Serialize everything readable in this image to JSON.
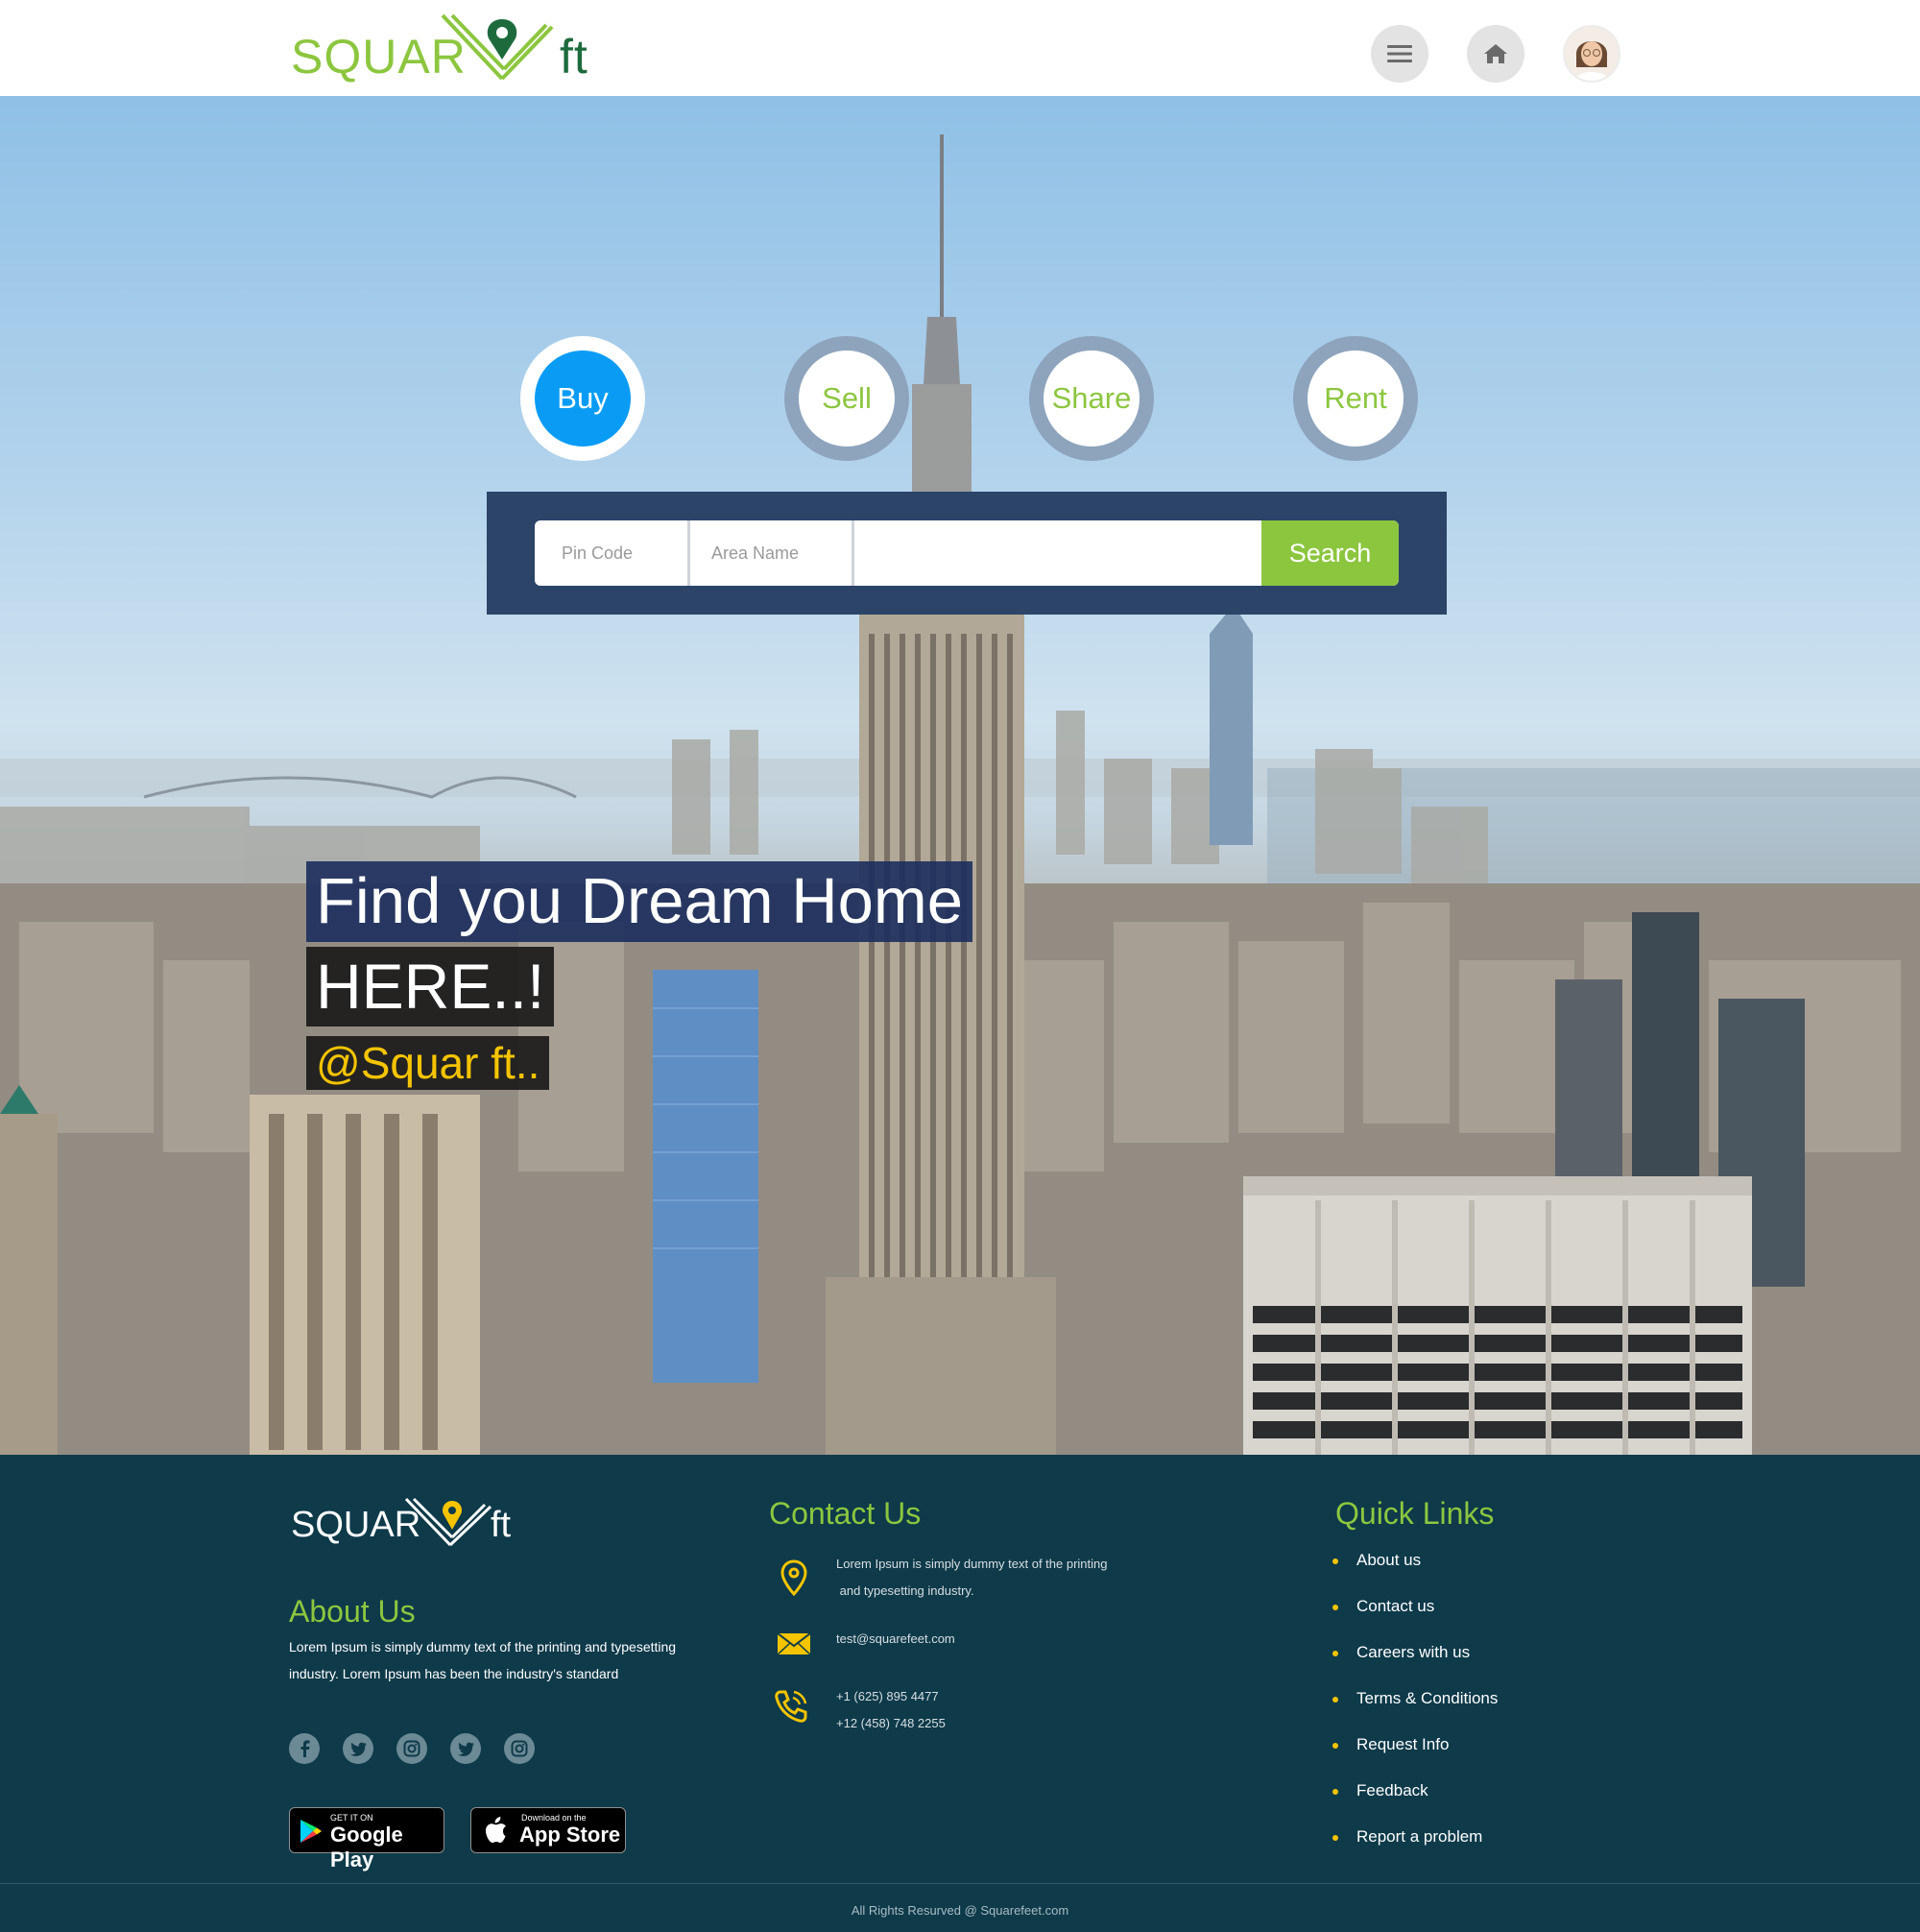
{
  "header": {
    "logo_left": "SQUAR",
    "logo_right": "ft",
    "menu_icon": "menu-icon",
    "home_icon": "home-icon",
    "avatar": "user-avatar"
  },
  "tabs": [
    {
      "label": "Buy",
      "active": true
    },
    {
      "label": "Sell",
      "active": false
    },
    {
      "label": "Share",
      "active": false
    },
    {
      "label": "Rent",
      "active": false
    }
  ],
  "search": {
    "pin_placeholder": "Pin Code",
    "area_placeholder": "Area Name",
    "query_value": "",
    "button_label": "Search"
  },
  "hero": {
    "headline": "Find you Dream Home",
    "subline": "HERE..!",
    "brand": "@Squar ft.."
  },
  "footer": {
    "logo_left": "SQUAR",
    "logo_right": "ft",
    "about": {
      "title": "About Us",
      "line1": "Lorem Ipsum is simply dummy text of the printing and typesetting",
      "line2": "industry. Lorem Ipsum has been the industry's standard"
    },
    "social": [
      "facebook-icon",
      "twitter-icon",
      "instagram-icon",
      "twitter-icon",
      "instagram-icon"
    ],
    "stores": {
      "google_small": "GET IT ON",
      "google_big": "Google Play",
      "apple_small": "Download on the",
      "apple_big": "App Store"
    },
    "contact": {
      "title": "Contact Us",
      "address_line1": "Lorem Ipsum is simply dummy text of the printing",
      "address_line2": " and typesetting industry.",
      "email": "test@squarefeet.com",
      "phone1": "+1 (625) 895 4477",
      "phone2": "+12 (458) 748 2255"
    },
    "quick_links": {
      "title": "Quick Links",
      "items": [
        "About us",
        "Contact us",
        "Careers with us",
        "Terms & Conditions",
        "Request Info",
        "Feedback",
        "Report a problem"
      ]
    },
    "copyright": "All Rights Resurved @ Squarefeet.com"
  },
  "colors": {
    "brand_green": "#8cc63f",
    "brand_dark_green": "#1d6b3d",
    "active_tab": "#0a9cf5",
    "search_panel": "#2c4468",
    "footer_bg": "#0e3a4a",
    "accent_yellow": "#f5c400"
  }
}
